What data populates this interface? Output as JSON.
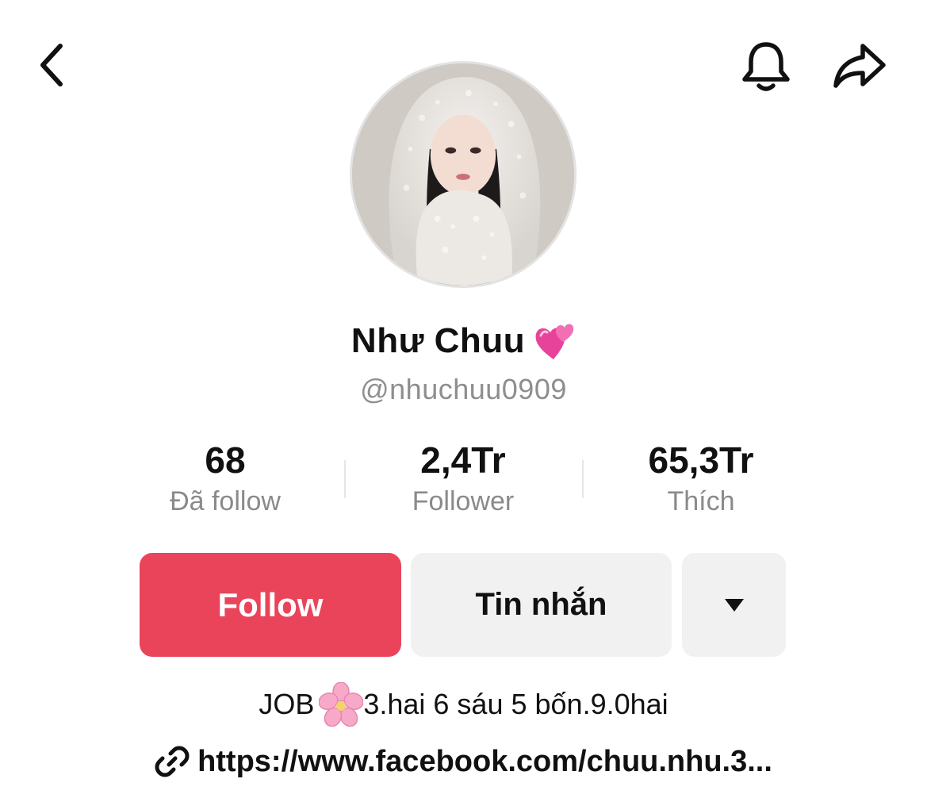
{
  "header": {
    "back_icon": "chevron-left-icon",
    "bell_icon": "bell-icon",
    "share_icon": "share-arrow-icon"
  },
  "profile": {
    "display_name": "Như Chuu",
    "name_emoji": "revolving-hearts-icon",
    "handle": "@nhuchuu0909"
  },
  "stats": [
    {
      "value": "68",
      "label": "Đã follow"
    },
    {
      "value": "2,4Tr",
      "label": "Follower"
    },
    {
      "value": "65,3Tr",
      "label": "Thích"
    }
  ],
  "actions": {
    "follow_label": "Follow",
    "message_label": "Tin nhắn",
    "more_icon": "caret-down-icon"
  },
  "bio": {
    "prefix": "JOB",
    "emoji": "cherry-blossom-icon",
    "text": "3.hai 6 sáu 5 bốn.9.0hai"
  },
  "link": {
    "text": "https://www.facebook.com/chuu.nhu.3..."
  },
  "colors": {
    "follow_button": "#ea445a",
    "secondary_button": "#f1f1f2",
    "muted_text": "#8a8a8a"
  }
}
